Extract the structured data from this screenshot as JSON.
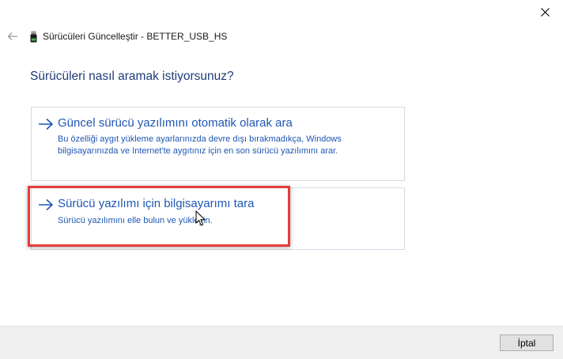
{
  "window": {
    "title": "Sürücüleri Güncelleştir - BETTER_USB_HS",
    "close_icon": "close-icon",
    "back_icon": "back-arrow-icon",
    "device_icon": "usb-device-icon"
  },
  "main": {
    "question": "Sürücüleri nasıl aramak istiyorsunuz?",
    "options": [
      {
        "title": "Güncel sürücü yazılımını otomatik olarak ara",
        "description": "Bu özelliği aygıt yükleme ayarlarınızda devre dışı bırakmadıkça, Windows bilgisayarınızda ve Internet'te aygıtınız için en son sürücü yazılımını arar.",
        "icon": "arrow-right-icon"
      },
      {
        "title": "Sürücü yazılımı için bilgisayarımı tara",
        "description": "Sürücü yazılımını elle bulun ve yükleyin.",
        "icon": "arrow-right-icon"
      }
    ]
  },
  "footer": {
    "cancel_label": "İptal"
  },
  "colors": {
    "link": "#1f57b4",
    "heading": "#1e3c78",
    "highlight": "#e53c3c",
    "footer_bg": "#f0f0f0"
  }
}
